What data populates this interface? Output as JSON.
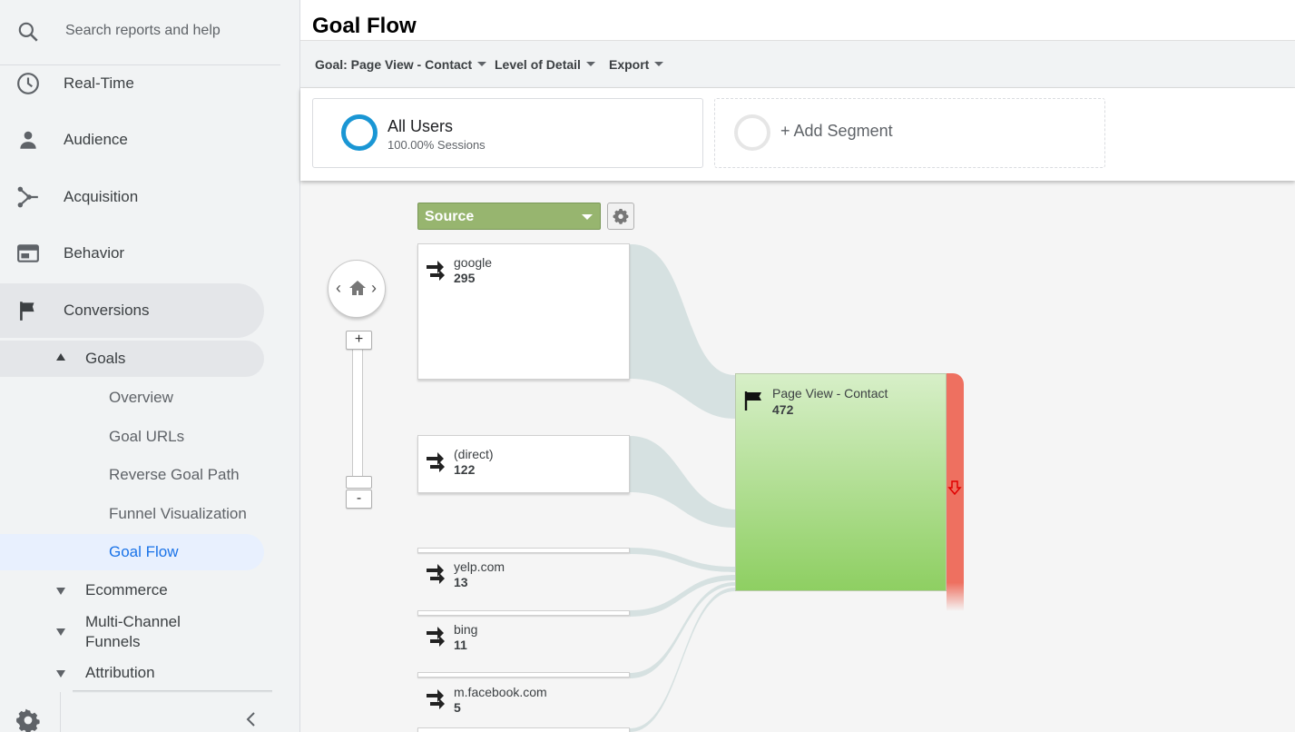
{
  "sidebar": {
    "search_placeholder": "Search reports and help",
    "nav": [
      {
        "label": "Real-Time",
        "icon": "clock-icon"
      },
      {
        "label": "Audience",
        "icon": "person-icon"
      },
      {
        "label": "Acquisition",
        "icon": "acquisition-icon"
      },
      {
        "label": "Behavior",
        "icon": "behavior-icon"
      },
      {
        "label": "Conversions",
        "icon": "flag-icon"
      }
    ],
    "goals_label": "Goals",
    "goal_items": [
      "Overview",
      "Goal URLs",
      "Reverse Goal Path",
      "Funnel Visualization",
      "Goal Flow"
    ],
    "selected_item": "Goal Flow",
    "sections": [
      "Ecommerce",
      "Multi-Channel Funnels",
      "Attribution"
    ]
  },
  "header": {
    "title": "Goal Flow"
  },
  "toolbar": {
    "goal": "Goal: Page View - Contact",
    "level": "Level of Detail",
    "export": "Export"
  },
  "segments": {
    "all_users": {
      "name": "All Users",
      "sub": "100.00% Sessions"
    },
    "add": "+ Add Segment"
  },
  "flow": {
    "dimension": "Source",
    "sources": [
      {
        "label": "google",
        "count": "295"
      },
      {
        "label": "(direct)",
        "count": "122"
      },
      {
        "label": "yelp.com",
        "count": "13"
      },
      {
        "label": "bing",
        "count": "11"
      },
      {
        "label": "m.facebook.com",
        "count": "5"
      }
    ],
    "goal": {
      "label": "Page View - Contact",
      "count": "472"
    }
  },
  "colors": {
    "accent": "#1a73e8",
    "source_dropdown": "#97b56f",
    "goal_node": "#8ecf62",
    "dropoff": "#ee7060",
    "flow_band": "#d6e1e1"
  }
}
